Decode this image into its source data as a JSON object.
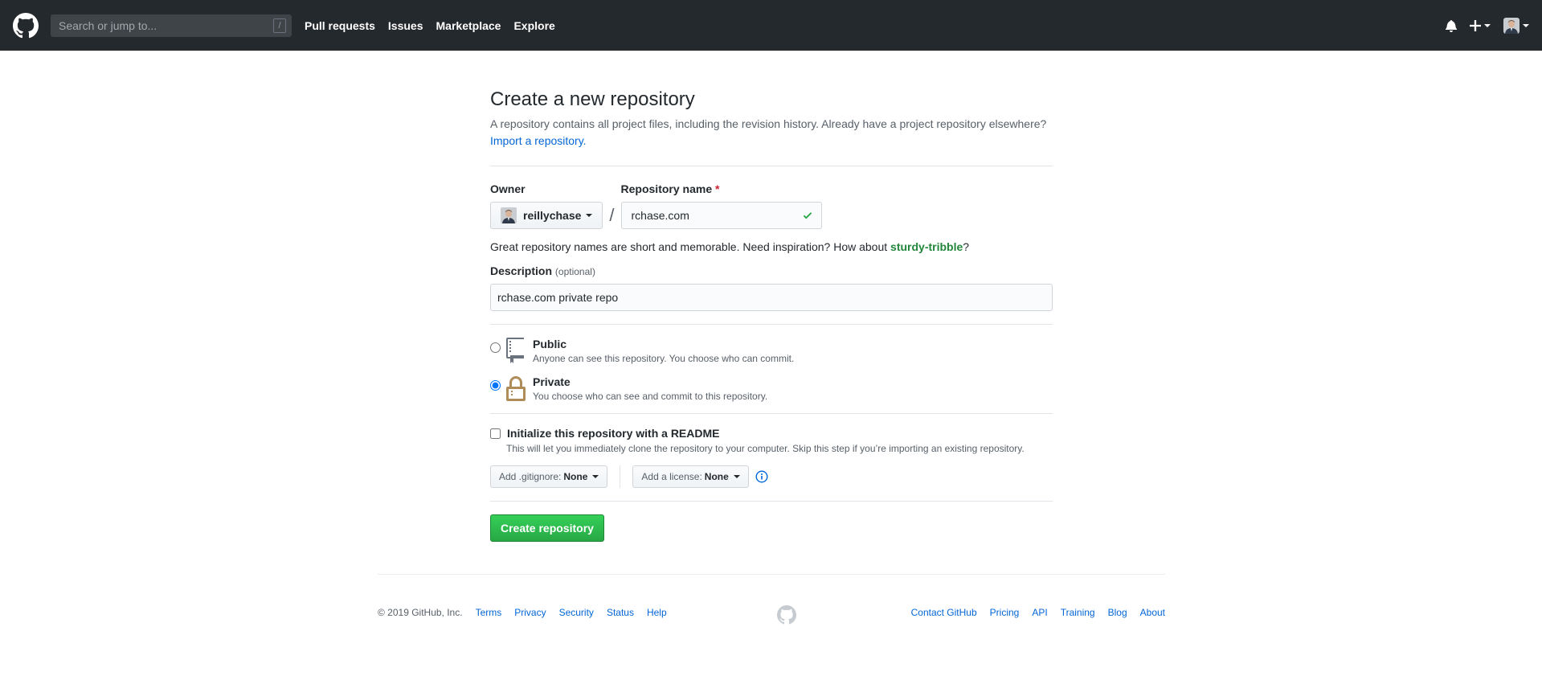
{
  "header": {
    "search_placeholder": "Search or jump to...",
    "search_shortcut": "/",
    "nav": [
      "Pull requests",
      "Issues",
      "Marketplace",
      "Explore"
    ],
    "icons": [
      "github-logo-icon",
      "bell-icon",
      "plus-icon",
      "avatar"
    ]
  },
  "page": {
    "title": "Create a new repository",
    "subtitle": "A repository contains all project files, including the revision history. Already have a project repository elsewhere?",
    "import_link": "Import a repository."
  },
  "form": {
    "owner_label": "Owner",
    "owner_value": "reillychase",
    "repo_name_label": "Repository name",
    "required_mark": "*",
    "repo_name_value": "rchase.com",
    "separator": "/",
    "hint_prefix": "Great repository names are short and memorable. Need inspiration? How about ",
    "hint_suggestion": "sturdy-tribble",
    "hint_suffix": "?",
    "description_label": "Description",
    "description_optional": "(optional)",
    "description_value": "rchase.com private repo",
    "visibility": [
      {
        "title": "Public",
        "note": "Anyone can see this repository. You choose who can commit.",
        "checked": false
      },
      {
        "title": "Private",
        "note": "You choose who can see and commit to this repository.",
        "checked": true
      }
    ],
    "readme_label": "Initialize this repository with a README",
    "readme_note": "This will let you immediately clone the repository to your computer. Skip this step if you’re importing an existing repository.",
    "readme_checked": false,
    "gitignore_label": "Add .gitignore:",
    "gitignore_value": "None",
    "license_label": "Add a license:",
    "license_value": "None",
    "submit_label": "Create repository"
  },
  "footer": {
    "copyright": "© 2019 GitHub, Inc.",
    "left_links": [
      "Terms",
      "Privacy",
      "Security",
      "Status",
      "Help"
    ],
    "right_links": [
      "Contact GitHub",
      "Pricing",
      "API",
      "Training",
      "Blog",
      "About"
    ]
  },
  "colors": {
    "header_bg": "#24292e",
    "link": "#0366d6",
    "success": "#28a745",
    "lock": "#b08c58"
  }
}
